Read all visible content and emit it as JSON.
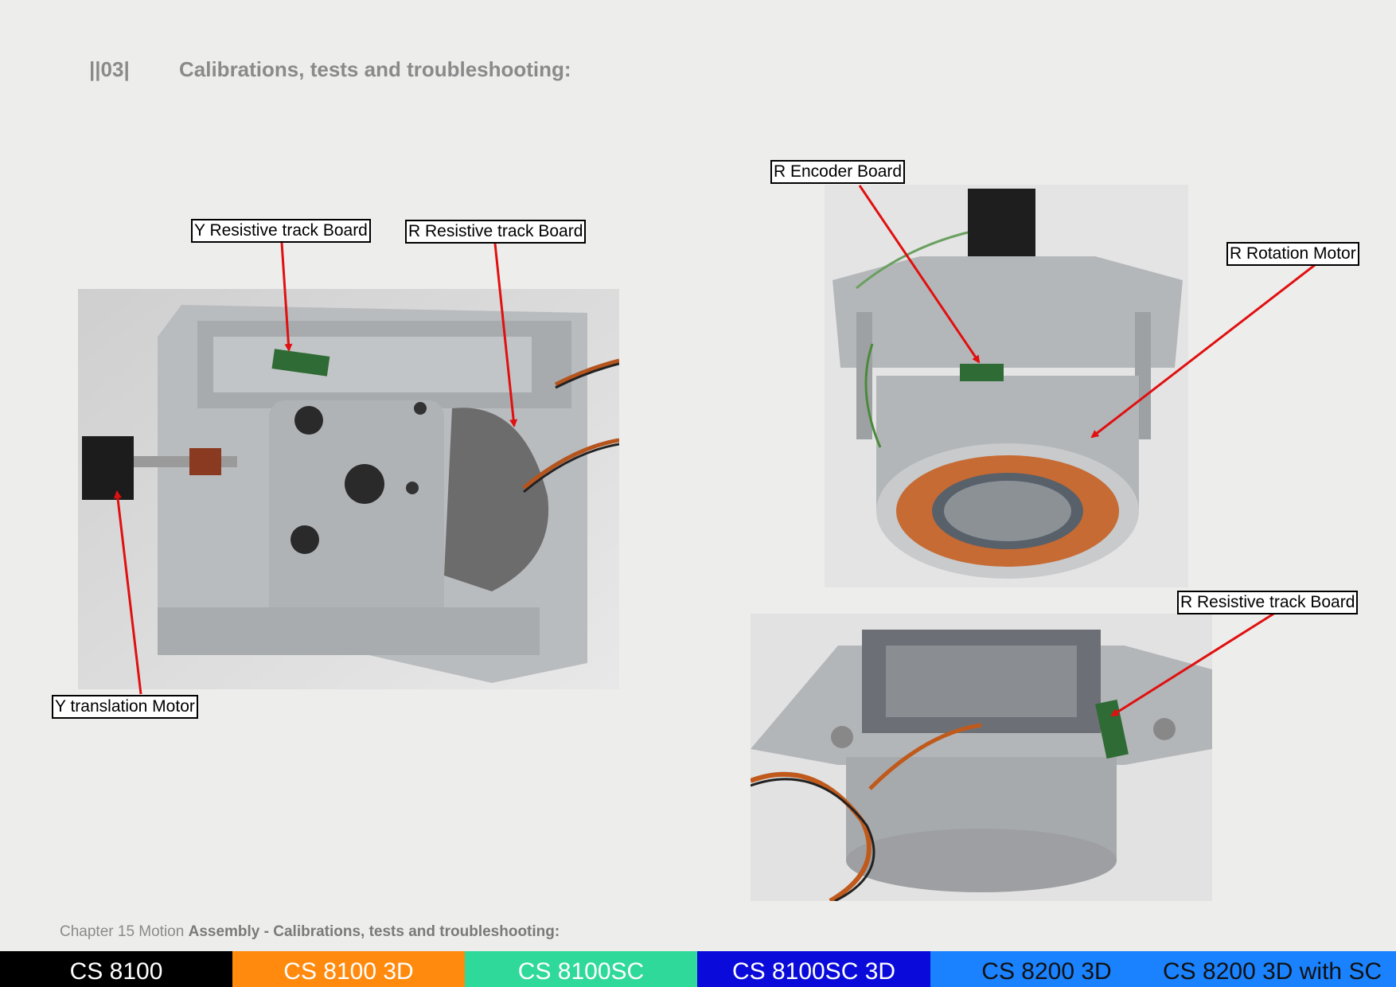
{
  "header": {
    "section_number": "||03|",
    "title": "Calibrations, tests and troubleshooting:"
  },
  "callouts": {
    "y_resistive": "Y Resistive track Board",
    "r_resistive_left": "R Resistive track Board",
    "y_motor": "Y translation Motor",
    "r_encoder": "R Encoder Board",
    "r_rotation": "R Rotation Motor",
    "r_resistive_right": "R Resistive track Board"
  },
  "footer": {
    "prefix": "Chapter 15 Motion ",
    "bold": "Assembly - Calibrations, tests and troubleshooting:"
  },
  "tabs": [
    {
      "label": "CS 8100",
      "bg": "#000000",
      "fg": "#ffffff"
    },
    {
      "label": "CS 8100 3D",
      "bg": "#ff8a0d",
      "fg": "#ffffff"
    },
    {
      "label": "CS 8100SC",
      "bg": "#2fd99a",
      "fg": "#ffffff"
    },
    {
      "label": "CS 8100SC 3D",
      "bg": "#0a0adb",
      "fg": "#ffffff"
    },
    {
      "label": "CS 8200 3D",
      "bg": "#1a82ff",
      "fg": "#111111"
    },
    {
      "label": "CS 8200 3D with SC",
      "bg": "#1a82ff",
      "fg": "#111111"
    }
  ],
  "colors": {
    "arrow": "#e01010",
    "background": "#ededec"
  }
}
